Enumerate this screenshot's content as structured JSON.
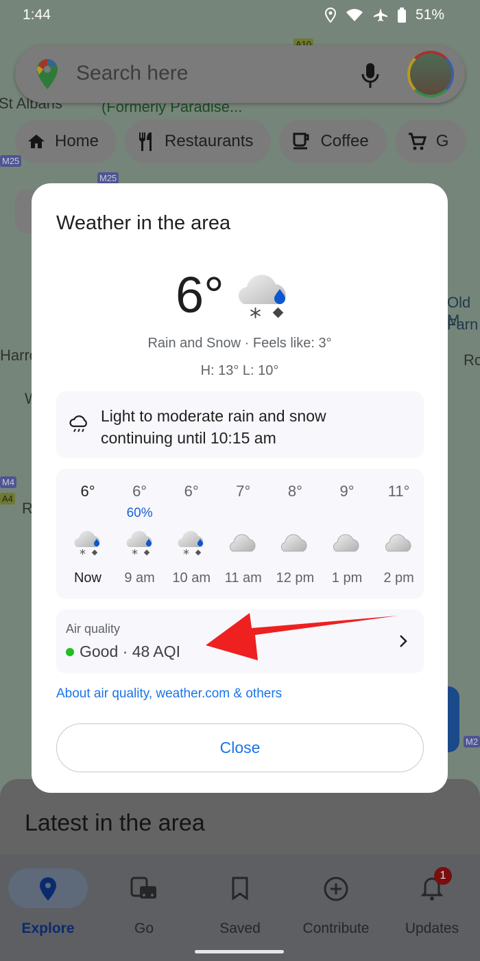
{
  "status_bar": {
    "time": "1:44",
    "battery": "51%",
    "icons": [
      "location-icon",
      "wifi-icon",
      "airplane-icon",
      "battery-icon"
    ]
  },
  "search": {
    "placeholder": "Search here"
  },
  "map_labels": [
    "St Albans",
    "(Formerly Paradise...",
    "Old M",
    "Farn",
    "Harro",
    "Ro",
    "W",
    "Ri"
  ],
  "road_labels": [
    "A10",
    "M25",
    "M25",
    "M4",
    "A4",
    "M2"
  ],
  "chips": [
    {
      "label": "Home",
      "icon": "home-icon"
    },
    {
      "label": "Restaurants",
      "icon": "restaurant-icon"
    },
    {
      "label": "Coffee",
      "icon": "coffee-icon"
    },
    {
      "label": "G",
      "icon": "cart-icon"
    }
  ],
  "dialog": {
    "title": "Weather in the area",
    "temperature": "6°",
    "condition": "Rain and Snow · Feels like: 3°",
    "high_low": "H: 13° L: 10°",
    "alert": "Light to moderate rain and snow continuing until 10:15 am",
    "hourly": [
      {
        "temp": "6°",
        "precip": "",
        "label": "Now",
        "icon": "rain-snow"
      },
      {
        "temp": "6°",
        "precip": "60%",
        "label": "9 am",
        "icon": "rain-snow"
      },
      {
        "temp": "6°",
        "precip": "",
        "label": "10 am",
        "icon": "rain-snow"
      },
      {
        "temp": "7°",
        "precip": "",
        "label": "11 am",
        "icon": "cloudy"
      },
      {
        "temp": "8°",
        "precip": "",
        "label": "12 pm",
        "icon": "cloudy"
      },
      {
        "temp": "9°",
        "precip": "",
        "label": "1 pm",
        "icon": "cloudy"
      },
      {
        "temp": "11°",
        "precip": "",
        "label": "2 pm",
        "icon": "cloudy"
      }
    ],
    "air_quality": {
      "label": "Air quality",
      "value": "Good · 48 AQI",
      "status_color": "#1fc01f"
    },
    "source_link": "About air quality, weather.com & others",
    "close_label": "Close"
  },
  "latest_title": "Latest in the area",
  "bottom_nav": [
    {
      "label": "Explore",
      "active": true
    },
    {
      "label": "Go"
    },
    {
      "label": "Saved"
    },
    {
      "label": "Contribute"
    },
    {
      "label": "Updates",
      "badge": "1"
    }
  ],
  "annotation": {
    "type": "red-arrow",
    "color": "#ee2020"
  }
}
